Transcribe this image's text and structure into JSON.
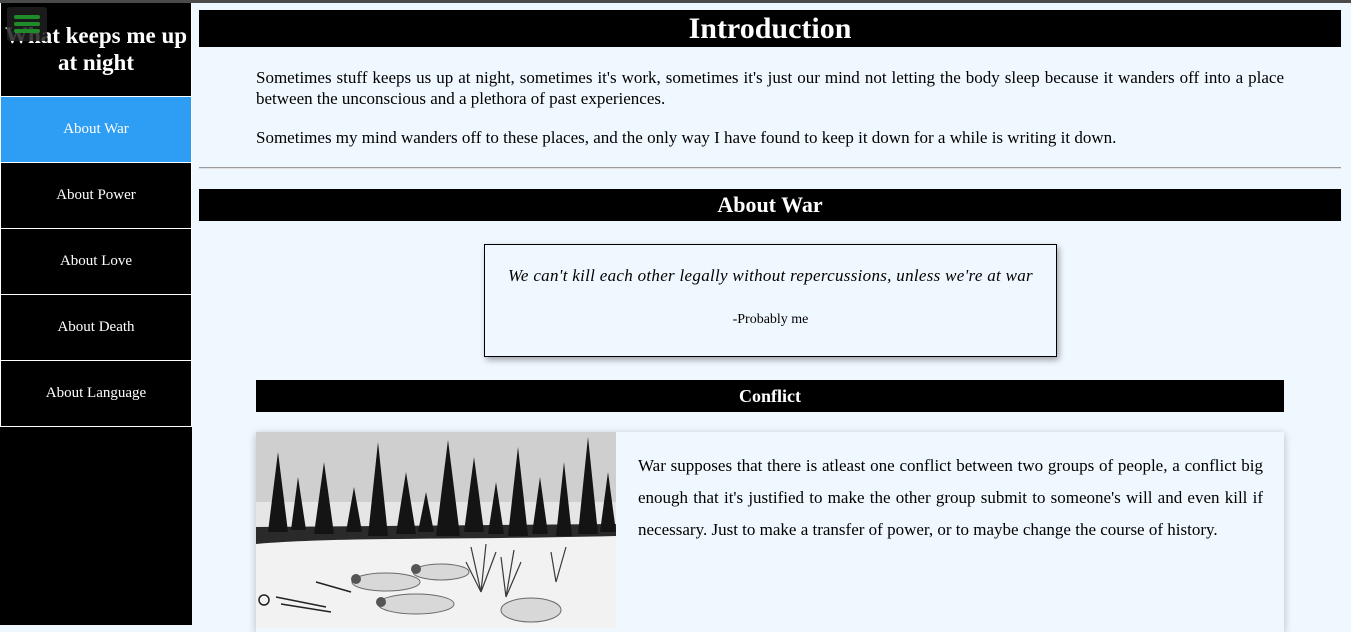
{
  "sidebar": {
    "title": "What keeps me up at night",
    "menu_icon": "hamburger-menu-icon",
    "items": [
      {
        "label": "About War",
        "active": true
      },
      {
        "label": "About Power",
        "active": false
      },
      {
        "label": "About Love",
        "active": false
      },
      {
        "label": "About Death",
        "active": false
      },
      {
        "label": "About Language",
        "active": false
      }
    ],
    "active_color": "#2e9ef5"
  },
  "intro": {
    "heading": "Introduction",
    "paragraphs": [
      "Sometimes stuff keeps us up at night, sometimes it's work, sometimes it's just our mind not letting the body sleep because it wanders off into a place between the unconscious and a plethora of past experiences.",
      "Sometimes my mind wanders off to these places, and the only way I have found to keep it down for a while is writing it down."
    ]
  },
  "war": {
    "heading": "About War",
    "quote": {
      "text": "We can't kill each other legally without repercussions, unless we're at war",
      "author": "-Probably me"
    },
    "conflict": {
      "heading": "Conflict",
      "image": "black-and-white photo of soldiers in white camouflage lying in snow near a pine forest",
      "text": "War supposes that there is atleast one conflict between two groups of people, a conflict big enough that it's justified to make the other group submit to someone's will and even kill if necessary. Just to make a transfer of power, or to maybe change the course of history."
    }
  }
}
